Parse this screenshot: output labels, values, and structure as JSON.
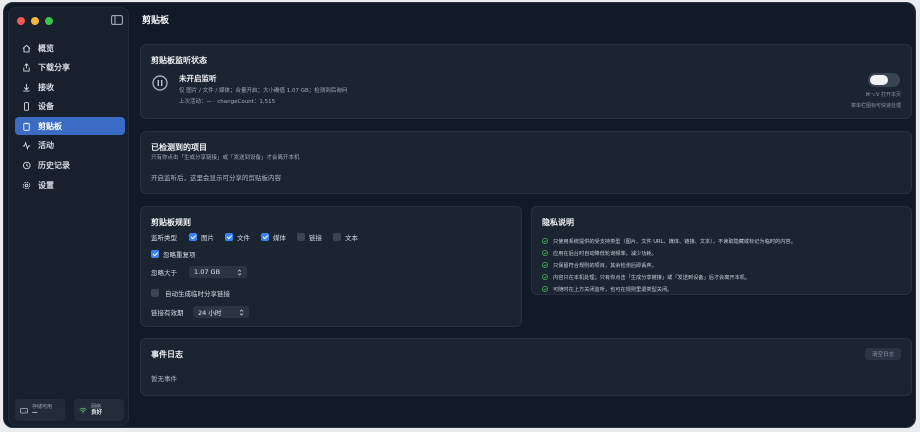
{
  "window": {
    "title": "剪贴板"
  },
  "sidebar": {
    "items": [
      {
        "label": "概览",
        "icon": "home-icon",
        "active": false
      },
      {
        "label": "下载分享",
        "icon": "share-upload-icon",
        "active": false
      },
      {
        "label": "接收",
        "icon": "download-arrow-icon",
        "active": false
      },
      {
        "label": "设备",
        "icon": "phone-icon",
        "active": false
      },
      {
        "label": "剪贴板",
        "icon": "clipboard-icon",
        "active": true
      },
      {
        "label": "活动",
        "icon": "activity-icon",
        "active": false
      },
      {
        "label": "历史记录",
        "icon": "history-icon",
        "active": false
      },
      {
        "label": "设置",
        "icon": "gear-icon",
        "active": false
      }
    ],
    "storage": {
      "label": "存储可用",
      "value": "—"
    },
    "network": {
      "label": "网络",
      "value": "良好"
    }
  },
  "monitor": {
    "title": "剪贴板监听状态",
    "status": "未开启监听",
    "desc": "仅 图片 / 文件 / 媒体；合量开启；大小确值 1.07 GB；检测到后询问",
    "last": "上次活动：— · changeCount：1,515",
    "shortcut": "⌘⌥V 打开本页",
    "hint": "菜单栏图标可快速处理"
  },
  "detected": {
    "title": "已检测到的项目",
    "subtitle": "只有你点击「生成分享链接」或「发送到设备」才会离开本机",
    "empty": "开启监听后，这里会显示可分享的剪贴板内容"
  },
  "rules": {
    "title": "剪贴板规则",
    "types_label": "监听类型",
    "types": [
      {
        "label": "图片",
        "checked": true
      },
      {
        "label": "文件",
        "checked": true
      },
      {
        "label": "媒体",
        "checked": true
      },
      {
        "label": "链接",
        "checked": false
      },
      {
        "label": "文本",
        "checked": false
      }
    ],
    "ignore_dup": "忽略重复项",
    "ignore_over_label": "忽略大于",
    "ignore_over_value": "1.07 GB",
    "auto_link": "自动生成临时分享链接",
    "link_valid_label": "链接有效期",
    "link_valid_value": "24 小时"
  },
  "privacy": {
    "title": "隐私说明",
    "items": [
      "只使用系统提供的受支持类型（图片、文件 URL、媒体、链接、文本），不读取隐藏或标记为临时的内容。",
      "应用在后台时自动降低轮询频率，减少功耗。",
      "只保留符合规则的项目，其余检测后即丢弃。",
      "内容只在本机处理；只有你点击「生成分享链接」或「发送到设备」后才会离开本机。",
      "可随时在上方关闭监听，也可在规则里退类型关闭。"
    ]
  },
  "log": {
    "title": "事件日志",
    "clear": "清空日志",
    "empty": "暂无事件"
  },
  "colors": {
    "accent": "#3b6cc4",
    "check": "#3b82f6",
    "ok": "#4caf6a"
  }
}
